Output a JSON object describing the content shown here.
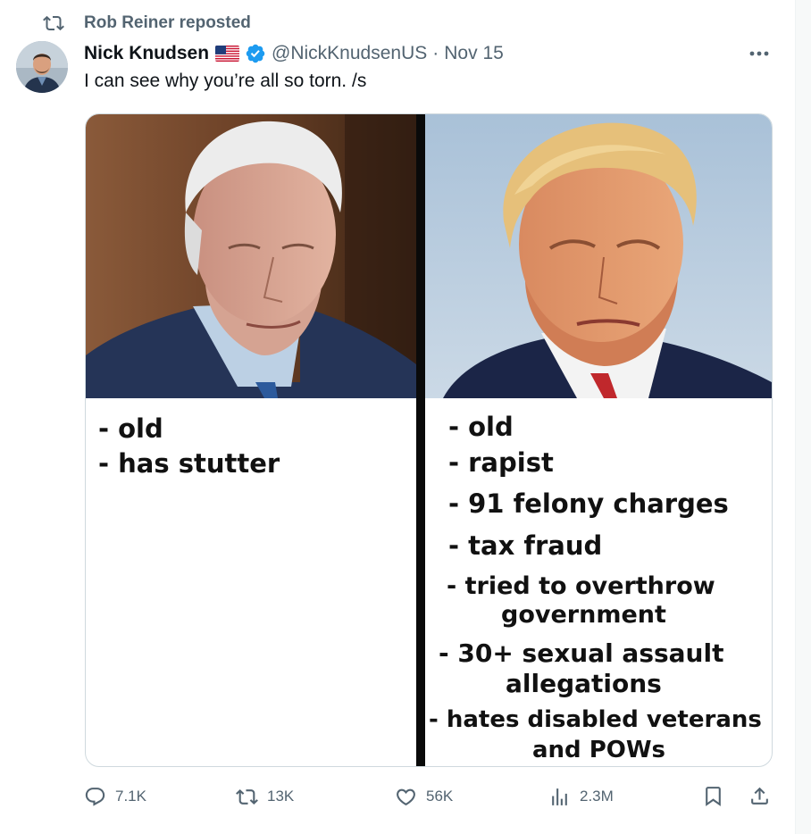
{
  "repost": {
    "text": "Rob Reiner reposted",
    "icon": "repost-icon"
  },
  "author": {
    "name": "Nick Knudsen",
    "flag_icon": "us-flag-icon",
    "verified_icon": "verified-badge-icon",
    "handle": "@NickKnudsenUS",
    "separator": "·",
    "date": "Nov 15"
  },
  "tweet": {
    "text": "I can see why you’re all so torn. /s"
  },
  "media": {
    "left_items": [
      "- old",
      "- has stutter"
    ],
    "right_items": [
      [
        "- old"
      ],
      [
        "- rapist"
      ],
      [
        "- 91 felony charges"
      ],
      [
        "- tax fraud"
      ],
      [
        "- tried to overthrow",
        "government"
      ],
      [
        "- 30+ sexual assault",
        "allegations"
      ],
      [
        "- hates disabled veterans",
        "and POWs"
      ]
    ]
  },
  "actions": {
    "replies": "7.1K",
    "reposts": "13K",
    "likes": "56K",
    "views": "2.3M"
  },
  "colors": {
    "muted": "#536471",
    "verified": "#1d9bf0",
    "text": "#0f1419"
  }
}
